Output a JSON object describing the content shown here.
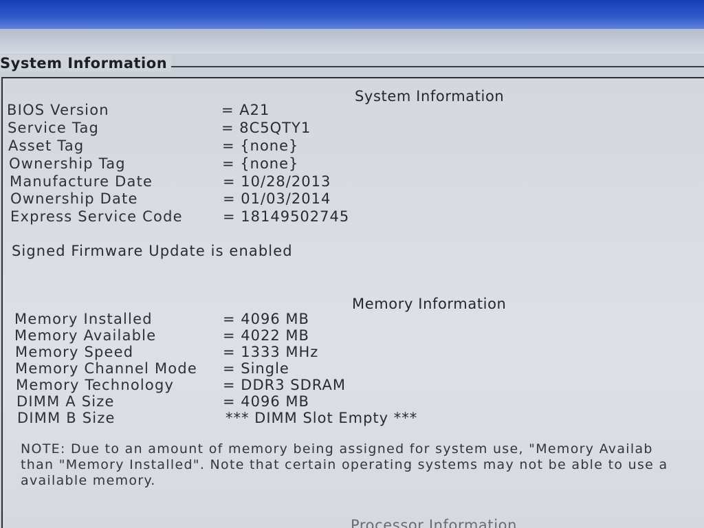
{
  "frame": {
    "group_title": "System Information"
  },
  "system_info": {
    "heading": "System Information",
    "rows": [
      {
        "label": "BIOS Version",
        "value": "= A21"
      },
      {
        "label": "Service Tag",
        "value": "= 8C5QTY1"
      },
      {
        "label": "Asset Tag",
        "value": "= {none}"
      },
      {
        "label": "Ownership Tag",
        "value": "= {none}"
      },
      {
        "label": "Manufacture Date",
        "value": "= 10/28/2013"
      },
      {
        "label": "Ownership Date",
        "value": "= 01/03/2014"
      },
      {
        "label": "Express Service Code",
        "value": "= 18149502745"
      }
    ],
    "firmware_status": "Signed Firmware Update is enabled"
  },
  "memory_info": {
    "heading": "Memory Information",
    "rows": [
      {
        "label": "Memory Installed",
        "value": "= 4096 MB"
      },
      {
        "label": "Memory Available",
        "value": "= 4022 MB"
      },
      {
        "label": "Memory Speed",
        "value": "= 1333 MHz"
      },
      {
        "label": "Memory Channel Mode",
        "value": "= Single"
      },
      {
        "label": "Memory Technology",
        "value": "= DDR3 SDRAM"
      },
      {
        "label": "DIMM A Size",
        "value": "= 4096 MB"
      },
      {
        "label": "DIMM B Size",
        "value": "*** DIMM Slot Empty ***"
      }
    ],
    "note_lines": [
      "NOTE: Due to an amount of memory being assigned for system use, \"Memory Availab",
      "than \"Memory Installed\". Note that certain operating systems may not be able to use a",
      "available memory."
    ]
  },
  "processor_info": {
    "heading": "Processor Information"
  }
}
